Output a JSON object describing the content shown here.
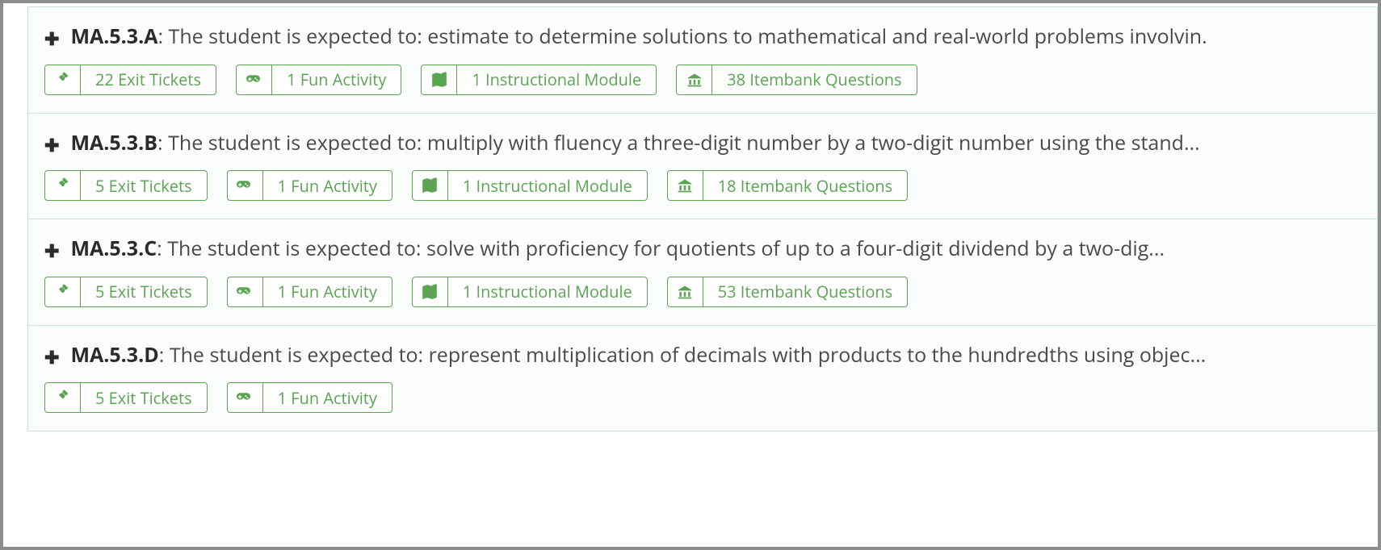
{
  "standards": [
    {
      "code": "MA.5.3.A",
      "description": "The student is expected to: estimate to determine solutions to mathematical and real-world problems involvin.",
      "badges": [
        {
          "icon": "ticket",
          "label": "22 Exit Tickets"
        },
        {
          "icon": "gamepad",
          "label": "1 Fun Activity"
        },
        {
          "icon": "map",
          "label": "1 Instructional Module"
        },
        {
          "icon": "bank",
          "label": "38 Itembank Questions"
        }
      ]
    },
    {
      "code": "MA.5.3.B",
      "description": "The student is expected to: multiply with fluency a three-digit number by a two-digit number using the stand...",
      "badges": [
        {
          "icon": "ticket",
          "label": "5 Exit Tickets"
        },
        {
          "icon": "gamepad",
          "label": "1 Fun Activity"
        },
        {
          "icon": "map",
          "label": "1 Instructional Module"
        },
        {
          "icon": "bank",
          "label": "18 Itembank Questions"
        }
      ]
    },
    {
      "code": "MA.5.3.C",
      "description": "The student is expected to: solve with proficiency for quotients of up to a four-digit dividend by a two-dig...",
      "badges": [
        {
          "icon": "ticket",
          "label": "5 Exit Tickets"
        },
        {
          "icon": "gamepad",
          "label": "1 Fun Activity"
        },
        {
          "icon": "map",
          "label": "1 Instructional Module"
        },
        {
          "icon": "bank",
          "label": "53 Itembank Questions"
        }
      ]
    },
    {
      "code": "MA.5.3.D",
      "description": "The student is expected to: represent multiplication of decimals with products to the hundredths using objec...",
      "badges": [
        {
          "icon": "ticket",
          "label": "5 Exit Tickets"
        },
        {
          "icon": "gamepad",
          "label": "1 Fun Activity"
        }
      ]
    }
  ]
}
